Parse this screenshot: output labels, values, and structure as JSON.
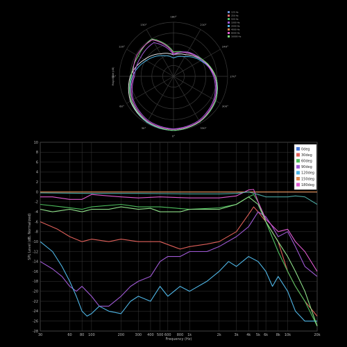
{
  "colors": {
    "background": "#000000",
    "grid": "#3a3a3a",
    "text": "#bbbbbb",
    "reference": "#ffd070"
  },
  "chart_data": [
    {
      "type": "polar",
      "angle_labels": [
        "0°",
        "30°",
        "60°",
        "90°",
        "120°",
        "150°",
        "180°",
        "210°",
        "240°",
        "270°",
        "300°",
        "330°"
      ],
      "radial_label": "Magnitude (dB)",
      "legend_placement": "top-right",
      "legend": [
        {
          "label": "125 Hz",
          "color": "#6a8fd6"
        },
        {
          "label": "250 Hz",
          "color": "#e06a6a"
        },
        {
          "label": "500 Hz",
          "color": "#4fc06a"
        },
        {
          "label": "1000 Hz",
          "color": "#a05ad6"
        },
        {
          "label": "2000 Hz",
          "color": "#4fb6e6"
        },
        {
          "label": "4000 Hz",
          "color": "#e08a50"
        },
        {
          "label": "8000 Hz",
          "color": "#e05ad0"
        },
        {
          "label": "16000 Hz",
          "color": "#7ae07a"
        }
      ],
      "series": [
        {
          "color": "#e8e8e8",
          "r": [
            1.0,
            0.98,
            0.92,
            0.8,
            0.62,
            0.48,
            0.4,
            0.46,
            0.6,
            0.78,
            0.9,
            0.97
          ]
        },
        {
          "color": "#4fb6e6",
          "r": [
            1.0,
            0.98,
            0.9,
            0.76,
            0.58,
            0.44,
            0.34,
            0.42,
            0.58,
            0.76,
            0.9,
            0.97
          ]
        },
        {
          "color": "#7ae07a",
          "r": [
            1.0,
            0.97,
            0.9,
            0.78,
            0.75,
            0.8,
            0.45,
            0.5,
            0.62,
            0.78,
            0.9,
            0.97
          ]
        },
        {
          "color": "#e05ad0",
          "r": [
            0.98,
            0.96,
            0.88,
            0.74,
            0.78,
            0.78,
            0.42,
            0.5,
            0.6,
            0.76,
            0.88,
            0.96
          ]
        },
        {
          "color": "#a05ad6",
          "r": [
            0.97,
            0.94,
            0.86,
            0.72,
            0.7,
            0.72,
            0.4,
            0.52,
            0.6,
            0.74,
            0.86,
            0.94
          ]
        }
      ]
    },
    {
      "type": "line",
      "xscale": "log",
      "xlabel": "Frequency (Hz)",
      "ylabel": "SPL Level (dB, Normalized)",
      "xlim": [
        30,
        20000
      ],
      "ylim": [
        -28,
        10
      ],
      "xticks": [
        30,
        60,
        80,
        100,
        200,
        300,
        400,
        500,
        600,
        800,
        1000,
        2000,
        3000,
        4000,
        5000,
        6000,
        8000,
        10000,
        20000
      ],
      "xtick_labels": [
        "30",
        "60",
        "80",
        "100",
        "200",
        "300",
        "400",
        "500",
        "600",
        "800",
        "1k",
        "2k",
        "3k",
        "4k",
        "5k",
        "6k",
        "8k",
        "10k",
        "20k"
      ],
      "yticks": [
        10,
        8,
        6,
        4,
        2,
        0,
        -2,
        -4,
        -6,
        -8,
        -10,
        -12,
        -14,
        -16,
        -18,
        -20,
        -22,
        -24,
        -26,
        -28
      ],
      "grid": true,
      "legend_placement": "top-right",
      "reference_line": 0,
      "series": [
        {
          "name": "0deg",
          "color": "#4a7ad8",
          "x": [
            30,
            100,
            300,
            1000,
            2000,
            3000,
            4000,
            5000,
            6000,
            8000,
            10000,
            15000,
            20000
          ],
          "y": [
            0,
            0,
            0,
            0,
            0,
            0,
            0,
            0,
            0,
            0,
            0,
            0,
            0
          ]
        },
        {
          "name": "30deg",
          "color": "#e0605a",
          "x": [
            30,
            45,
            60,
            80,
            100,
            150,
            200,
            300,
            500,
            800,
            1000,
            1500,
            2000,
            3000,
            4000,
            4500,
            5000,
            6000,
            8000,
            10000,
            12000,
            15000,
            20000
          ],
          "y": [
            -6,
            -7.5,
            -9,
            -10,
            -9.5,
            -10,
            -9.5,
            -10,
            -10,
            -11.5,
            -11,
            -10.5,
            -10,
            -8,
            -4.5,
            -3,
            -4,
            -6,
            -10,
            -16,
            -19,
            -22,
            -25
          ]
        },
        {
          "name": "60deg",
          "color": "#4ec05e",
          "x": [
            30,
            50,
            80,
            100,
            200,
            300,
            500,
            1000,
            2000,
            3000,
            4000,
            4500,
            5000,
            6000,
            8000,
            10000,
            12000,
            15000,
            20000
          ],
          "y": [
            -2.5,
            -3,
            -3.5,
            -3,
            -2.5,
            -3,
            -3,
            -3.5,
            -3.2,
            -2.5,
            -1,
            -0.5,
            -2,
            -6,
            -12,
            -16,
            -19,
            -22,
            -27
          ]
        },
        {
          "name": "90deg",
          "color": "#a05ad6",
          "x": [
            30,
            40,
            50,
            60,
            70,
            80,
            100,
            120,
            150,
            200,
            250,
            300,
            400,
            500,
            600,
            800,
            1000,
            1500,
            2000,
            3000,
            4000,
            5000,
            6000,
            7000,
            8000,
            10000,
            12000,
            15000,
            20000
          ],
          "y": [
            -14,
            -15.5,
            -17,
            -19,
            -20,
            -19,
            -21,
            -23,
            -23,
            -21,
            -19,
            -18,
            -17,
            -14,
            -13,
            -13,
            -12,
            -12,
            -11,
            -9,
            -7,
            -4,
            -5,
            -7,
            -9,
            -8,
            -11,
            -15,
            -17
          ]
        },
        {
          "name": "120deg",
          "color": "#4fb6e6",
          "x": [
            30,
            40,
            50,
            60,
            70,
            80,
            90,
            100,
            120,
            150,
            200,
            250,
            300,
            400,
            500,
            600,
            800,
            1000,
            1500,
            2000,
            2500,
            3000,
            4000,
            5000,
            6000,
            7000,
            8000,
            10000,
            12000,
            15000,
            20000
          ],
          "y": [
            -10,
            -12,
            -15,
            -18,
            -21,
            -24,
            -25,
            -24.5,
            -23,
            -24,
            -24.5,
            -22,
            -21,
            -22,
            -19,
            -21,
            -19,
            -20,
            -18,
            -16,
            -14,
            -15,
            -13,
            -14,
            -16,
            -19,
            -17,
            -20,
            -24,
            -26,
            -26
          ]
        },
        {
          "name": "150deg",
          "color": "#e08a50",
          "x": [
            30,
            100,
            300,
            1000,
            2000,
            3000,
            4000,
            5000,
            6000,
            8000,
            10000,
            15000,
            20000
          ],
          "y": [
            0,
            0,
            0,
            0,
            0,
            0,
            0,
            0,
            0,
            0,
            0,
            0,
            0
          ]
        },
        {
          "name": "180deg",
          "color": "#e05ad0",
          "x": [
            30,
            40,
            60,
            80,
            100,
            150,
            200,
            300,
            500,
            1000,
            2000,
            3000,
            4000,
            4500,
            5000,
            6000,
            8000,
            10000,
            12000,
            15000,
            20000
          ],
          "y": [
            -1,
            -1,
            -1.5,
            -1.5,
            -0.5,
            -0.8,
            -1,
            -1.2,
            -1,
            -1.2,
            -1.2,
            -0.8,
            0.4,
            0.5,
            -2,
            -5.5,
            -8,
            -7.5,
            -10,
            -12,
            -16
          ]
        },
        {
          "name": "",
          "color": "#8fe08a",
          "x": [
            30,
            40,
            60,
            80,
            100,
            150,
            200,
            300,
            400,
            500,
            800,
            1000,
            2000,
            3000,
            4000,
            5000,
            6000,
            8000,
            10000,
            12000,
            15000,
            20000
          ],
          "y": [
            -3.5,
            -4,
            -3.5,
            -4,
            -3.5,
            -3.5,
            -3,
            -3.5,
            -3.3,
            -4,
            -4,
            -3.5,
            -3.5,
            -2.5,
            -1,
            -2.5,
            -6,
            -10,
            -13,
            -16,
            -20,
            -27
          ]
        },
        {
          "name": "",
          "color": "#4aa7a0",
          "x": [
            30,
            100,
            300,
            1000,
            2000,
            3000,
            4000,
            5000,
            6000,
            8000,
            10000,
            12000,
            15000,
            20000
          ],
          "y": [
            -0.2,
            -0.3,
            -0.3,
            -0.4,
            -0.4,
            -0.3,
            0,
            -0.5,
            -1,
            -1,
            -1,
            -0.8,
            -1,
            -2.5
          ]
        }
      ]
    }
  ]
}
